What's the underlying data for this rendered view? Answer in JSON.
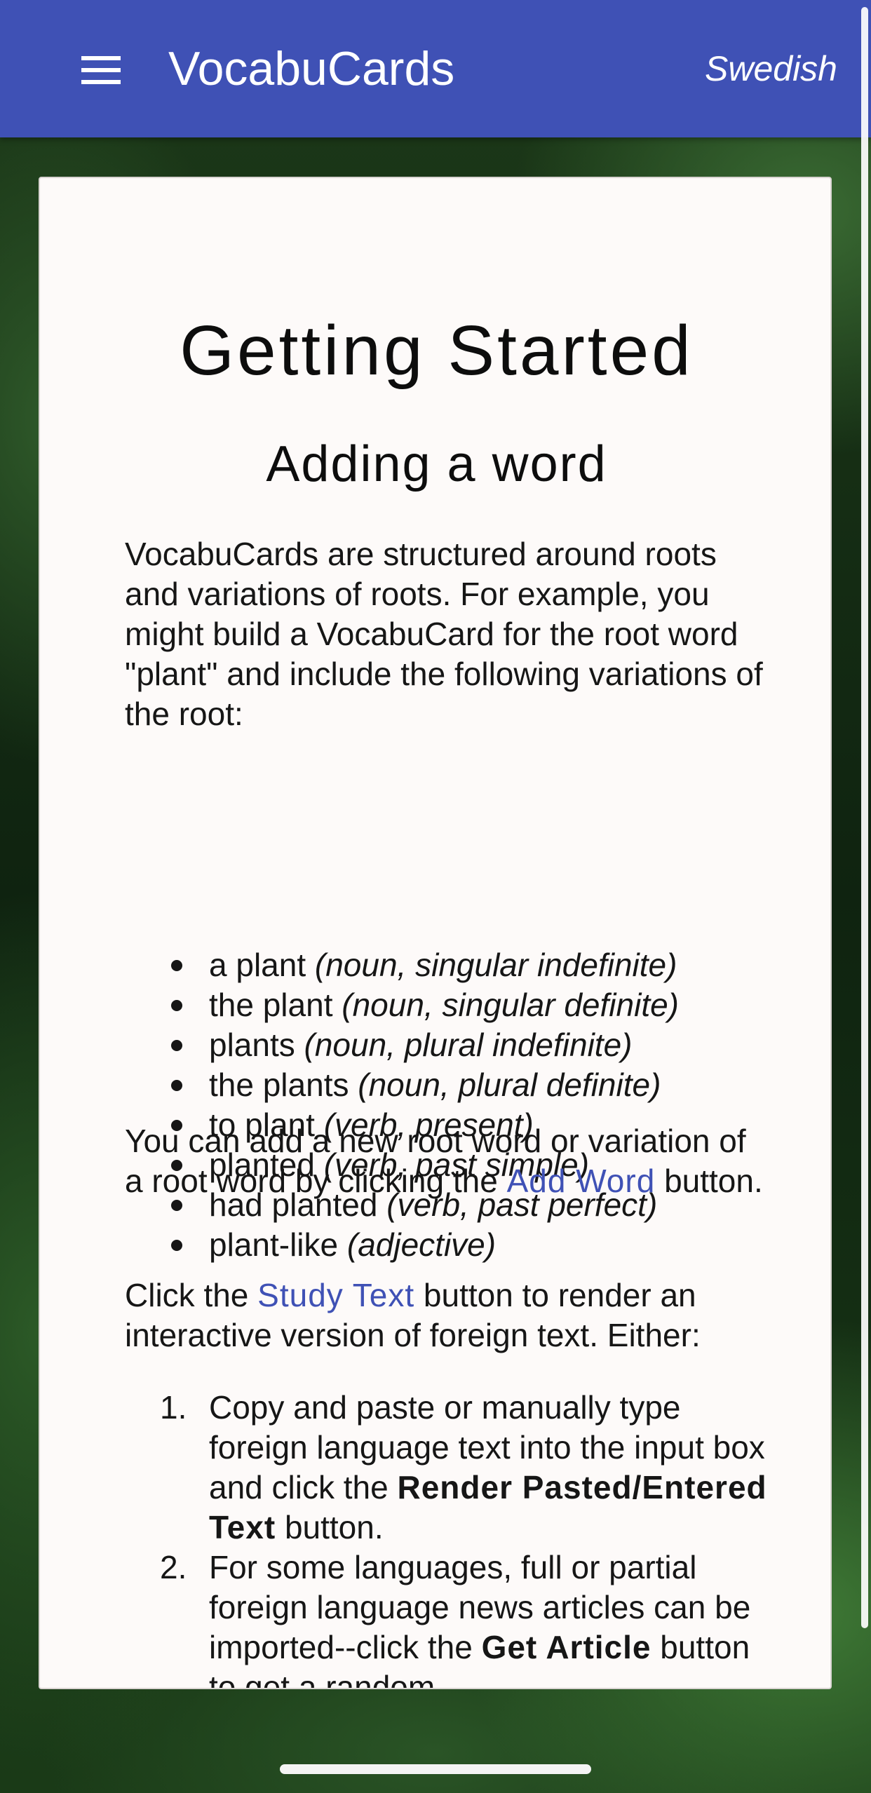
{
  "app_bar": {
    "title": "VocabuCards",
    "language": "Swedish",
    "menu_icon": "hamburger-menu-icon",
    "background_color": "#3f51b5"
  },
  "card": {
    "heading": "Getting Started",
    "subheading": "Adding a word",
    "intro": "VocabuCards are structured around roots and variations of roots. For example, you might build a VocabuCard for the root word \"plant\" and include the following variations of the root:",
    "variations": [
      {
        "word": "a plant",
        "note": "(noun, singular indefinite)"
      },
      {
        "word": "the plant",
        "note": "(noun, singular definite)"
      },
      {
        "word": "plants",
        "note": "(noun, plural indefinite)"
      },
      {
        "word": "the plants",
        "note": "(noun, plural definite)"
      },
      {
        "word": "to plant",
        "note": "(verb, present)"
      },
      {
        "word": "planted",
        "note": "(verb, past simple)"
      },
      {
        "word": "had planted",
        "note": "(verb, past perfect)"
      },
      {
        "word": "plant-like",
        "note": "(adjective)"
      }
    ],
    "add_word_text_before": "You can add a new root word or variation of a root word by clicking the ",
    "add_word_link": "Add Word",
    "add_word_text_after": " button.",
    "study_text_before": "Click the ",
    "study_text_link": "Study Text",
    "study_text_after": " button to render an interactive version of foreign text. Either:",
    "steps": [
      {
        "number": "1.",
        "before": "Copy and paste or manually type foreign language text into the input box and click the ",
        "bold": "Render Pasted/Entered Text",
        "after": " button."
      },
      {
        "number": "2.",
        "before": "For some languages, full or partial foreign language news articles can be imported--click the ",
        "bold": "Get Article",
        "after": " button to get a random"
      }
    ],
    "link_color": "#3f51b5"
  }
}
